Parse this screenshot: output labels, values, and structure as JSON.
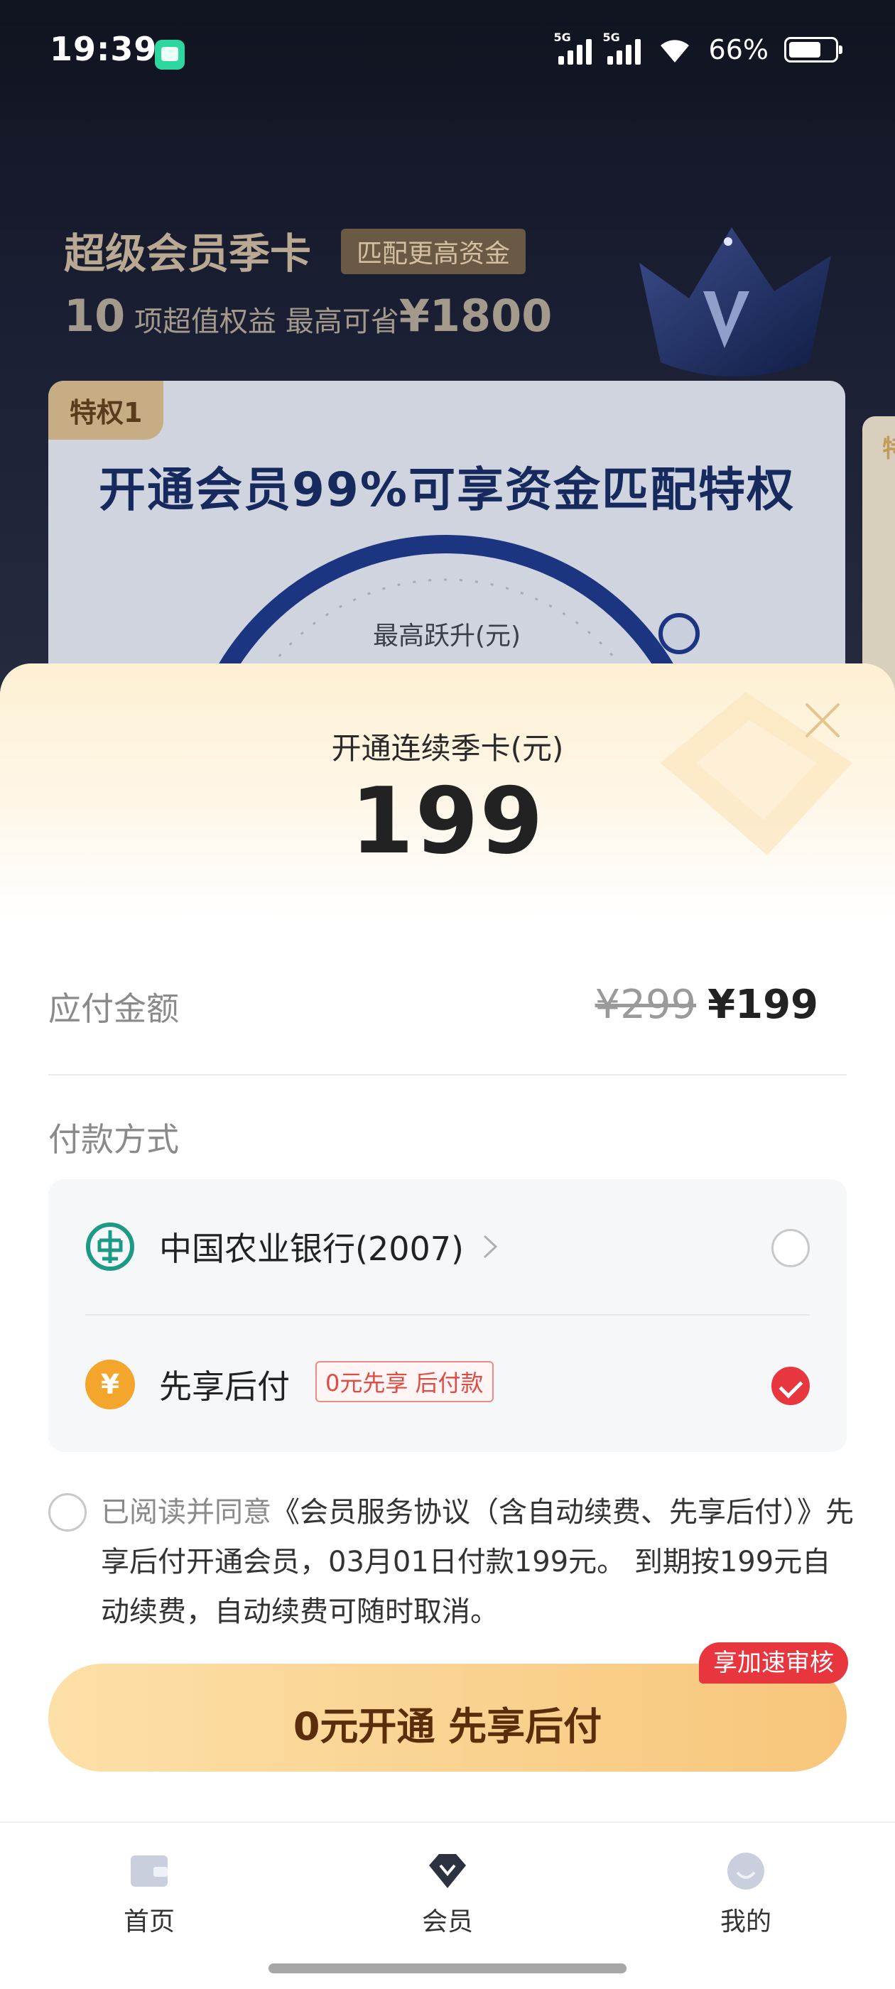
{
  "status_bar": {
    "time": "19:39",
    "network_1": "5G",
    "network_2": "5G",
    "battery": "66%"
  },
  "hero": {
    "title": "超级会员季卡",
    "tag": "匹配更高资金",
    "sub_count": "10",
    "sub_text": " 项超值权益   最高可省",
    "sub_amount": "¥1800",
    "crown_icon": "crown-icon"
  },
  "privilege_card": {
    "badge": "特权1",
    "title": "开通会员99%可享资金匹配特权",
    "gauge_label": "最高跃升(元)",
    "next_badge": "特"
  },
  "sheet": {
    "subtitle": "开通连续季卡(元)",
    "price": "199",
    "amount_label": "应付金额",
    "amount_original": "¥299",
    "amount_now": "¥199",
    "pay_label": "付款方式",
    "payment_methods": [
      {
        "name": "中国农业银行(2007)",
        "icon": "bank-icon",
        "selected": false
      },
      {
        "name": "先享后付",
        "icon": "yuan-icon",
        "tag": "0元先享 后付款",
        "selected": true
      }
    ],
    "agreement_prefix": "已阅读并同意",
    "agreement_link": "《会员服务协议（含自动续费、先享后付）》",
    "agreement_body": "先享后付开通会员，03月01日付款199元。 到期按199元自动续费，自动续费可随时取消。",
    "cta_label": "0元开通 先享后付",
    "cta_badge": "享加速审核"
  },
  "nav": {
    "items": [
      {
        "label": "首页",
        "icon": "wallet-icon"
      },
      {
        "label": "会员",
        "icon": "diamond-icon",
        "active": true
      },
      {
        "label": "我的",
        "icon": "profile-icon"
      }
    ]
  },
  "colors": {
    "accent_red": "#e8363e",
    "cta_gold": "#f7c67b",
    "hero_navy": "#172a5e"
  }
}
